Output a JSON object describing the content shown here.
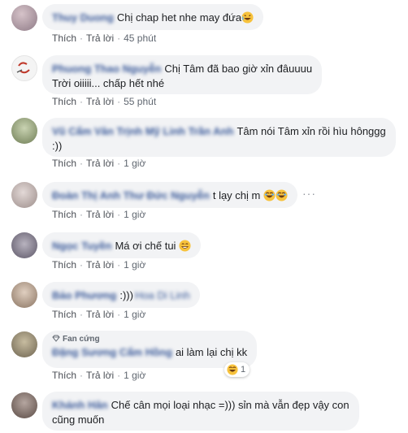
{
  "labels": {
    "like": "Thích",
    "reply": "Trả lời",
    "top_fan": "Fan cứng"
  },
  "comments": [
    {
      "author": "Thuy Duong",
      "lines": [
        "Chị chap het nhe may đứa"
      ],
      "emoji": "laugh",
      "time": "45 phút"
    },
    {
      "author": "Phuong Thao Nguyễn",
      "lines": [
        "Chị Tâm đã bao giờ xỉn đâuuuu",
        "Trời oiiiii... chấp hết nhé"
      ],
      "time": "55 phút"
    },
    {
      "author": "Vũ Cẩm Vân Trịnh Mỹ Linh Trần Anh",
      "lines": [
        "Tâm nói Tâm xỉn rồi hìu hônggg",
        ":))"
      ],
      "time": "1 giờ"
    },
    {
      "author": "Đoàn Thị Anh Thư Đức Nguyễn",
      "lines": [
        "t lạy chị m"
      ],
      "time": "1 giờ"
    },
    {
      "author": "Ngọc Tuyền",
      "lines": [
        "Má ơi chế tui"
      ],
      "time": "1 giờ"
    },
    {
      "author": "Bảo Phương",
      "lines": [
        ":)))"
      ],
      "mention": "Hoa Di Linh",
      "time": "1 giờ"
    },
    {
      "author": "Đặng Sương Cẩm Hồng",
      "lines": [
        "ai làm lại chị kk"
      ],
      "time": "1 giờ",
      "reaction_count": "1"
    },
    {
      "author": "Khánh Hân",
      "lines": [
        "Chế cân mọi loại nhạc =))) sỉn mà vẫn đẹp vậy con",
        "cũng muốn"
      ]
    }
  ]
}
